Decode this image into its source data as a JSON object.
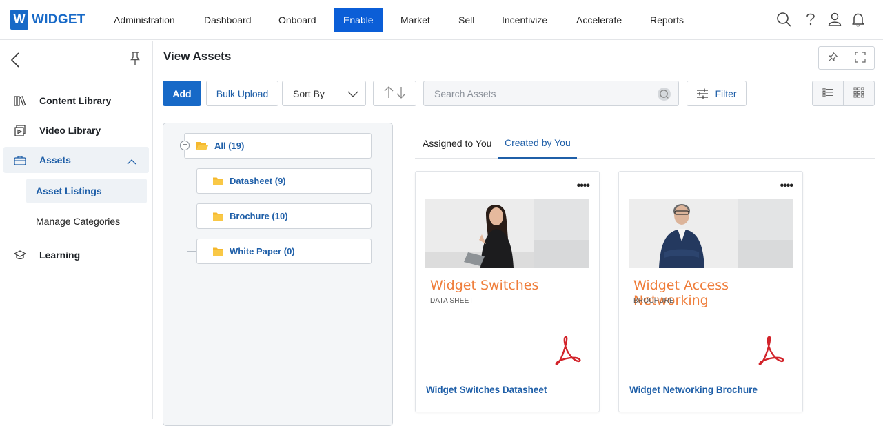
{
  "brand": {
    "logo_letter": "W",
    "logo_text": "WIDGET",
    "accent": "#1769c7",
    "active_nav_bg": "#0b5ed7"
  },
  "topnav": {
    "items": [
      {
        "label": "Administration"
      },
      {
        "label": "Dashboard"
      },
      {
        "label": "Onboard"
      },
      {
        "label": "Enable"
      },
      {
        "label": "Market"
      },
      {
        "label": "Sell"
      },
      {
        "label": "Incentivize"
      },
      {
        "label": "Accelerate"
      },
      {
        "label": "Reports"
      }
    ],
    "active": "Enable",
    "icons": [
      "search-icon",
      "help-icon",
      "user-icon",
      "notification-bell-icon"
    ]
  },
  "sidebar": {
    "items": [
      {
        "label": "Content Library",
        "icon": "books-icon"
      },
      {
        "label": "Video Library",
        "icon": "video-icon"
      },
      {
        "label": "Assets",
        "icon": "briefcase-icon",
        "expanded": true
      },
      {
        "label": "Learning",
        "icon": "graduation-cap-icon"
      }
    ],
    "sub_items": [
      {
        "label": "Asset Listings",
        "active": true
      },
      {
        "label": "Manage Categories"
      }
    ]
  },
  "main": {
    "title": "View Assets",
    "toolbar": {
      "add_label": "Add",
      "bulk_upload_label": "Bulk Upload",
      "sort_label": "Sort By",
      "search_placeholder": "Search Assets",
      "filter_label": "Filter"
    },
    "tree": {
      "root": "All (19)",
      "children": [
        "Datasheet (9)",
        "Brochure (10)",
        "White Paper (0)"
      ]
    },
    "tabs": [
      {
        "label": "Assigned to You"
      },
      {
        "label": "Created by You",
        "active": true
      }
    ],
    "cards": [
      {
        "title": "Widget Switches",
        "type": "DATA SHEET",
        "link": "Widget Switches Datasheet"
      },
      {
        "title": "Widget Access Networking",
        "type": "BROCHURE",
        "link": "Widget Networking Brochure"
      }
    ]
  }
}
